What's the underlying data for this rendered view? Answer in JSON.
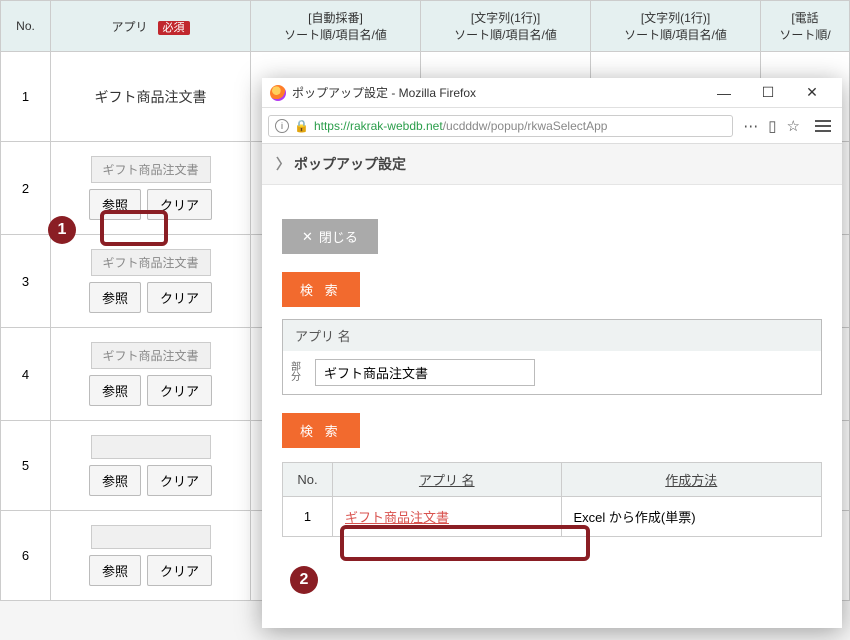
{
  "bg": {
    "headers": {
      "no": "No.",
      "app": "アプリ",
      "required": "必須",
      "col1a": "[自動採番]",
      "col1b": "ソート順/項目名/値",
      "col2a": "[文字列(1行)]",
      "col2b": "ソート順/項目名/値",
      "col3a": "[文字列(1行)]",
      "col3b": "ソート順/項目名/値",
      "col4a": "[電話",
      "col4b": "ソート順/"
    },
    "row1_app": "ギフト商品注文書",
    "app_placeholder": "ギフト商品注文書",
    "btn_browse": "参照",
    "btn_clear": "クリア",
    "row_numbers": [
      "1",
      "2",
      "3",
      "4",
      "5",
      "6"
    ]
  },
  "popup": {
    "window_title": "ポップアップ設定 - Mozilla Firefox",
    "url_secure": "https://rakrak-webdb.net",
    "url_rest": "/ucdddw/popup/rkwaSelectApp",
    "breadcrumb": "ポップアップ設定",
    "close_label": "閉じる",
    "search_label": "検 索",
    "filter_header": "アプリ 名",
    "filter_small": "部分",
    "filter_value": "ギフト商品注文書",
    "results": {
      "th_no": "No.",
      "th_name": "アプリ 名",
      "th_method": "作成方法",
      "rows": [
        {
          "no": "1",
          "name": "ギフト商品注文書",
          "method": "Excel から作成(単票)"
        }
      ]
    }
  },
  "markers": {
    "m1": "1",
    "m2": "2"
  }
}
